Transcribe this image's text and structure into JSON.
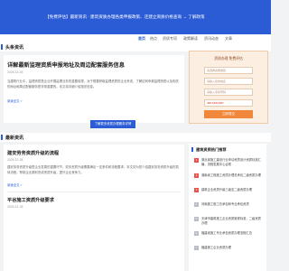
{
  "banner": {
    "text": "【免费评估】最新资讯 · 建筑资质办理各类申报政策、还建立资质价格查询 → 了解政策"
  },
  "nav": {
    "items": [
      "首页",
      "热点",
      "资质专项",
      "政策解读",
      "资讯动态",
      "文章"
    ]
  },
  "top_news": {
    "heading": "头条资讯",
    "article": {
      "title": "详解最新监理资质申报地址及周边配套服务信息",
      "date": "2025-12-28",
      "summary": "当建筑行业中，监理资质是企业开展监理业务的重要前提。对于想要获取监理资质的企业来说，了解如何申报监理资质以及相关的地址和周边配套服务是非常重要的。本文将详细介绍相关信息。",
      "more": "阅读全文 >"
    },
    "cta_label": "了解更多资质办理服务详情"
  },
  "latest_news": {
    "heading": "最新资讯",
    "articles": [
      {
        "title": "建安劳务资质升级的流程",
        "date": "2025-12-28",
        "summary": "建安劳务资质升级是企业发展的重要环节，劳务资质升级需要满足一定条件和流程要求，本文将为您介绍建安劳务资质升级的具体流程，帮助企业顺利完成资质升级，提升企业竞争力。",
        "more": "阅读全文 >"
      },
      {
        "title": "平谷施工资质升级要求",
        "date": "2025-12-28"
      }
    ]
  },
  "sidebar_form": {
    "title": "资质办理 免费评估",
    "fields": [
      "请选择资质类别",
      "请输入您的姓名",
      "请输入手机号码",
      "400-1234-567"
    ],
    "submit_label": "立即提交"
  },
  "sidebar_list": {
    "heading": "建筑资质热门推荐",
    "items": [
      "湖北省施工建设行业申请资质设计资质标准汇编，流程发展中心合规",
      "湖南省工程施工资质办理总承包二级资质办理",
      "建筑企业资质升级三级至二级资质办理",
      "河南施工施工总承包和专业承包资质",
      "天津市建筑施工企业资质新规标准，二级资质办理",
      "福建省施工专业承包资质办理流程汇总",
      "福建施工企业资质办理"
    ]
  }
}
